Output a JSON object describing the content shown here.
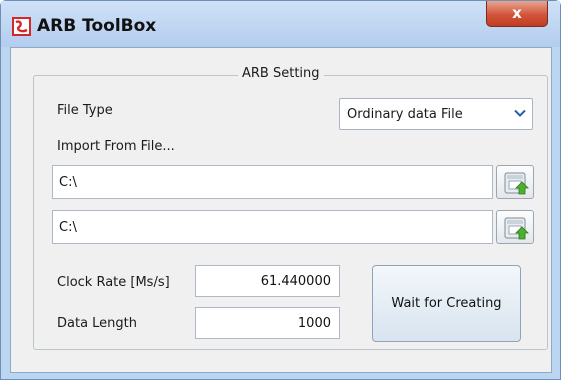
{
  "window": {
    "title": "ARB ToolBox",
    "close_label": "x",
    "icons": {
      "app": "app-logo-icon",
      "close": "close-icon"
    }
  },
  "group": {
    "title": "ARB Setting"
  },
  "file_type": {
    "label": "File Type",
    "selected": "Ordinary data File",
    "icon": "chevron-down-icon"
  },
  "import": {
    "label": "Import From File...",
    "path1": "C:\\",
    "path2": "C:\\",
    "browse_icon": "folder-browse-icon"
  },
  "clock_rate": {
    "label": "Clock Rate [Ms/s]",
    "value": "61.440000"
  },
  "data_length": {
    "label": "Data Length",
    "value": "1000"
  },
  "actions": {
    "wait_label": "Wait for Creating"
  },
  "colors": {
    "window_frame": "#bcd6f1",
    "client_bg": "#f0f0f0",
    "close_red": "#d2553b"
  }
}
